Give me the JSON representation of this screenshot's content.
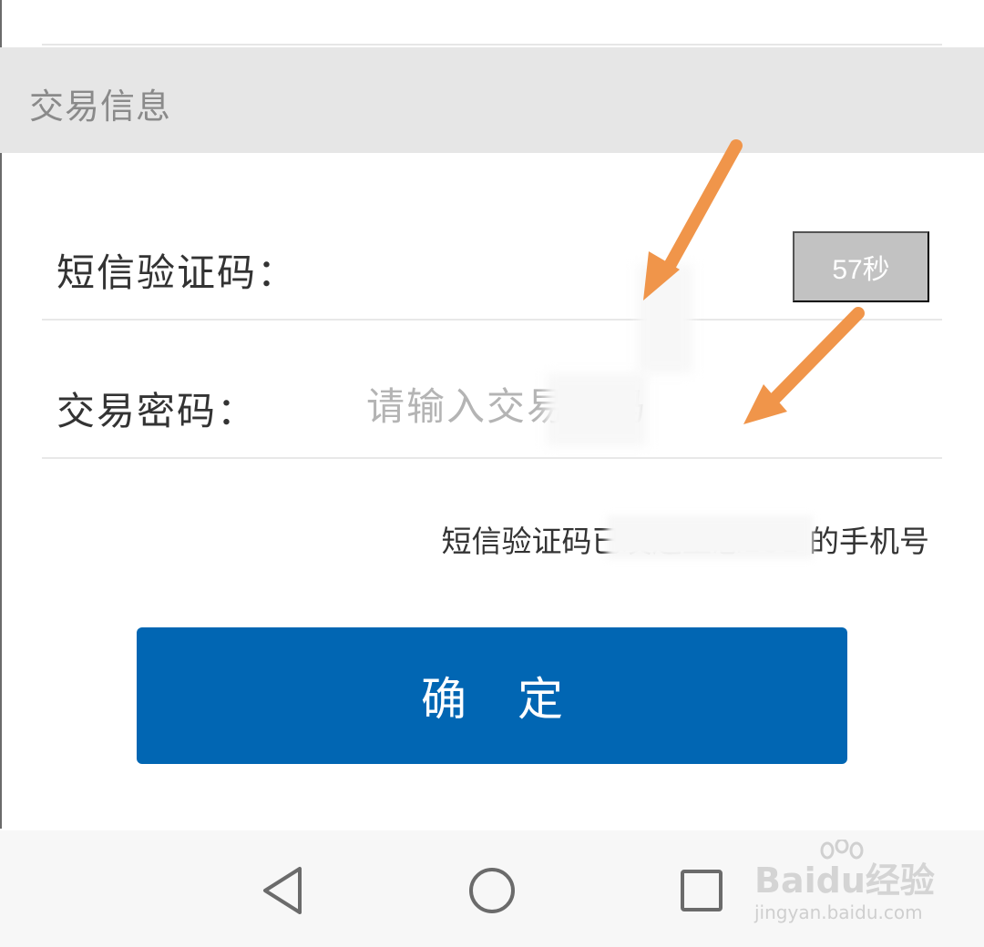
{
  "section": {
    "title": "交易信息"
  },
  "sms": {
    "label": "短信验证码：",
    "countdown_label": "57秒"
  },
  "password": {
    "label": "交易密码：",
    "placeholder": "请输入交易密码"
  },
  "hint": "短信验证码已发送至您181            的手机号",
  "confirm_label": "确 定",
  "watermark": {
    "brand": "Baidu经验",
    "url": "jingyan.baidu.com"
  },
  "icons": {
    "back": "back-triangle-icon",
    "home": "home-circle-icon",
    "recents": "recents-square-icon",
    "annotation_arrow": "arrow-icon"
  },
  "colors": {
    "accent": "#0166b3",
    "annotation_arrow": "#f0954a",
    "header_bg": "#e6e6e6",
    "countdown_bg": "#c2c2c2"
  }
}
